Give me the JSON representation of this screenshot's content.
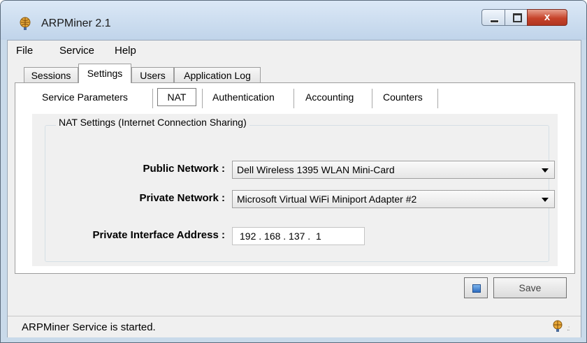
{
  "window": {
    "title": "ARPMiner 2.1",
    "close_glyph": "x"
  },
  "menu": [
    "File",
    "Service",
    "Help"
  ],
  "outer_tabs": [
    {
      "label": "Sessions",
      "active": false
    },
    {
      "label": "Settings",
      "active": true
    },
    {
      "label": "Users",
      "active": false
    },
    {
      "label": "Application Log",
      "active": false
    }
  ],
  "inner_tabs": [
    {
      "label": "Service Parameters",
      "active": false
    },
    {
      "label": "NAT",
      "active": true
    },
    {
      "label": "Authentication",
      "active": false
    },
    {
      "label": "Accounting",
      "active": false
    },
    {
      "label": "Counters",
      "active": false
    }
  ],
  "nat": {
    "group_title": "NAT Settings (Internet Connection Sharing)",
    "public_network_label": "Public Network :",
    "public_network_value": "Dell Wireless 1395 WLAN Mini-Card",
    "private_network_label": "Private Network :",
    "private_network_value": "Microsoft Virtual WiFi Miniport Adapter #2",
    "private_address_label": "Private Interface Address :",
    "private_address_value": "192 . 168 . 137 .  1"
  },
  "buttons": {
    "save_label": "Save"
  },
  "status": {
    "text": "ARPMiner Service is started."
  },
  "icons": {
    "app": "network-globe-icon",
    "stop": "stop-icon",
    "tray": "network-globe-icon"
  }
}
